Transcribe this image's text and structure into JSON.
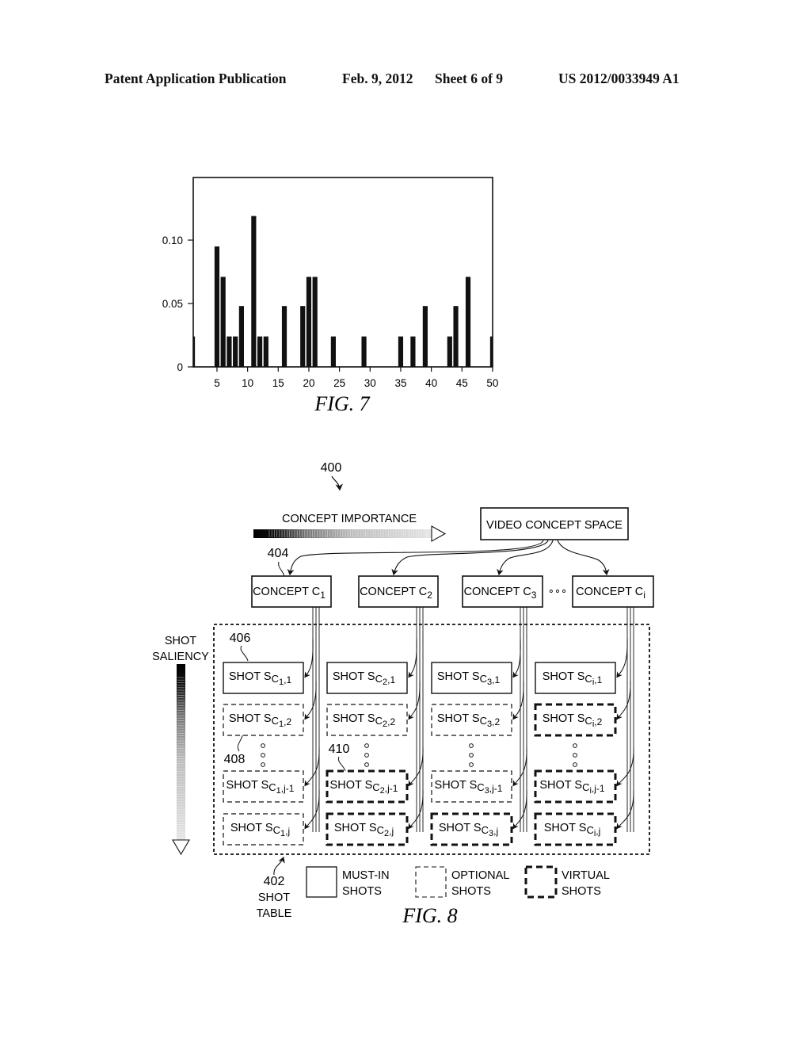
{
  "header": {
    "publication": "Patent Application Publication",
    "date": "Feb. 9, 2012",
    "sheet": "Sheet 6 of 9",
    "patent_number": "US 2012/0033949 A1"
  },
  "chart_data": {
    "type": "bar",
    "title": "",
    "caption": "FIG. 7",
    "xlabel": "",
    "ylabel": "",
    "xlim": [
      1,
      50
    ],
    "ylim": [
      0,
      0.15
    ],
    "x_ticks": [
      5,
      10,
      15,
      20,
      25,
      30,
      35,
      40,
      45,
      50
    ],
    "x_tick_labels": [
      "5",
      "10",
      "15",
      "20",
      "25",
      "30",
      "35",
      "40",
      "45",
      "50"
    ],
    "y_ticks": [
      0,
      0.05,
      0.1
    ],
    "y_tick_labels": [
      "0",
      "0.05",
      "0.10"
    ],
    "grid": false,
    "legend": "none",
    "x": [
      1,
      5,
      6,
      7,
      8,
      9,
      11,
      12,
      13,
      16,
      19,
      20,
      21,
      24,
      29,
      35,
      37,
      39,
      43,
      44,
      46,
      50
    ],
    "values": [
      0.024,
      0.095,
      0.071,
      0.024,
      0.024,
      0.048,
      0.119,
      0.024,
      0.024,
      0.048,
      0.048,
      0.071,
      0.071,
      0.024,
      0.024,
      0.024,
      0.024,
      0.048,
      0.024,
      0.048,
      0.071,
      0.024
    ]
  },
  "fig8": {
    "caption": "FIG. 8",
    "ref_400": "400",
    "ref_402": "402",
    "ref_402_label_1": "SHOT",
    "ref_402_label_2": "TABLE",
    "ref_404": "404",
    "ref_406": "406",
    "ref_408": "408",
    "ref_410": "410",
    "concept_importance": "CONCEPT IMPORTANCE",
    "shot_saliency_1": "SHOT",
    "shot_saliency_2": "SALIENCY",
    "video_concept_space": "VIDEO CONCEPT SPACE",
    "ellipsis": "∘∘∘",
    "concepts": [
      {
        "label": "CONCEPT C",
        "sub": "1"
      },
      {
        "label": "CONCEPT C",
        "sub": "2"
      },
      {
        "label": "CONCEPT C",
        "sub": "3"
      },
      {
        "label": "CONCEPT C",
        "sub": "i"
      }
    ],
    "shot_columns": [
      {
        "concept_sub": "1",
        "shots": [
          {
            "label": "SHOT S",
            "sub": "C",
            "csub": "1",
            "idx": ",1",
            "type": "must-in"
          },
          {
            "label": "SHOT S",
            "sub": "C",
            "csub": "1",
            "idx": ",2",
            "type": "optional"
          },
          {
            "label": "SHOT S",
            "sub": "C",
            "csub": "1",
            "idx": ",j-1",
            "type": "optional"
          },
          {
            "label": "SHOT S",
            "sub": "C",
            "csub": "1",
            "idx": ",j",
            "type": "optional"
          }
        ]
      },
      {
        "concept_sub": "2",
        "shots": [
          {
            "label": "SHOT S",
            "sub": "C",
            "csub": "2",
            "idx": ",1",
            "type": "must-in"
          },
          {
            "label": "SHOT S",
            "sub": "C",
            "csub": "2",
            "idx": ",2",
            "type": "optional"
          },
          {
            "label": "SHOT S",
            "sub": "C",
            "csub": "2",
            "idx": ",j-1",
            "type": "virtual"
          },
          {
            "label": "SHOT S",
            "sub": "C",
            "csub": "2",
            "idx": ",j",
            "type": "virtual"
          }
        ]
      },
      {
        "concept_sub": "3",
        "shots": [
          {
            "label": "SHOT S",
            "sub": "C",
            "csub": "3",
            "idx": ",1",
            "type": "must-in"
          },
          {
            "label": "SHOT S",
            "sub": "C",
            "csub": "3",
            "idx": ",2",
            "type": "optional"
          },
          {
            "label": "SHOT S",
            "sub": "C",
            "csub": "3",
            "idx": ",j-1",
            "type": "optional"
          },
          {
            "label": "SHOT S",
            "sub": "C",
            "csub": "3",
            "idx": ",j",
            "type": "virtual"
          }
        ]
      },
      {
        "concept_sub": "i",
        "shots": [
          {
            "label": "SHOT S",
            "sub": "C",
            "csub": "i",
            "idx": ",1",
            "type": "must-in"
          },
          {
            "label": "SHOT S",
            "sub": "C",
            "csub": "i",
            "idx": ",2",
            "type": "virtual"
          },
          {
            "label": "SHOT S",
            "sub": "C",
            "csub": "i",
            "idx": ",j-1",
            "type": "virtual"
          },
          {
            "label": "SHOT S",
            "sub": "C",
            "csub": "i",
            "idx": ",j",
            "type": "virtual"
          }
        ]
      }
    ],
    "legend": [
      {
        "type": "must-in",
        "line1": "MUST-IN",
        "line2": "SHOTS"
      },
      {
        "type": "optional",
        "line1": "OPTIONAL",
        "line2": "SHOTS"
      },
      {
        "type": "virtual",
        "line1": "VIRTUAL",
        "line2": "SHOTS"
      }
    ]
  }
}
